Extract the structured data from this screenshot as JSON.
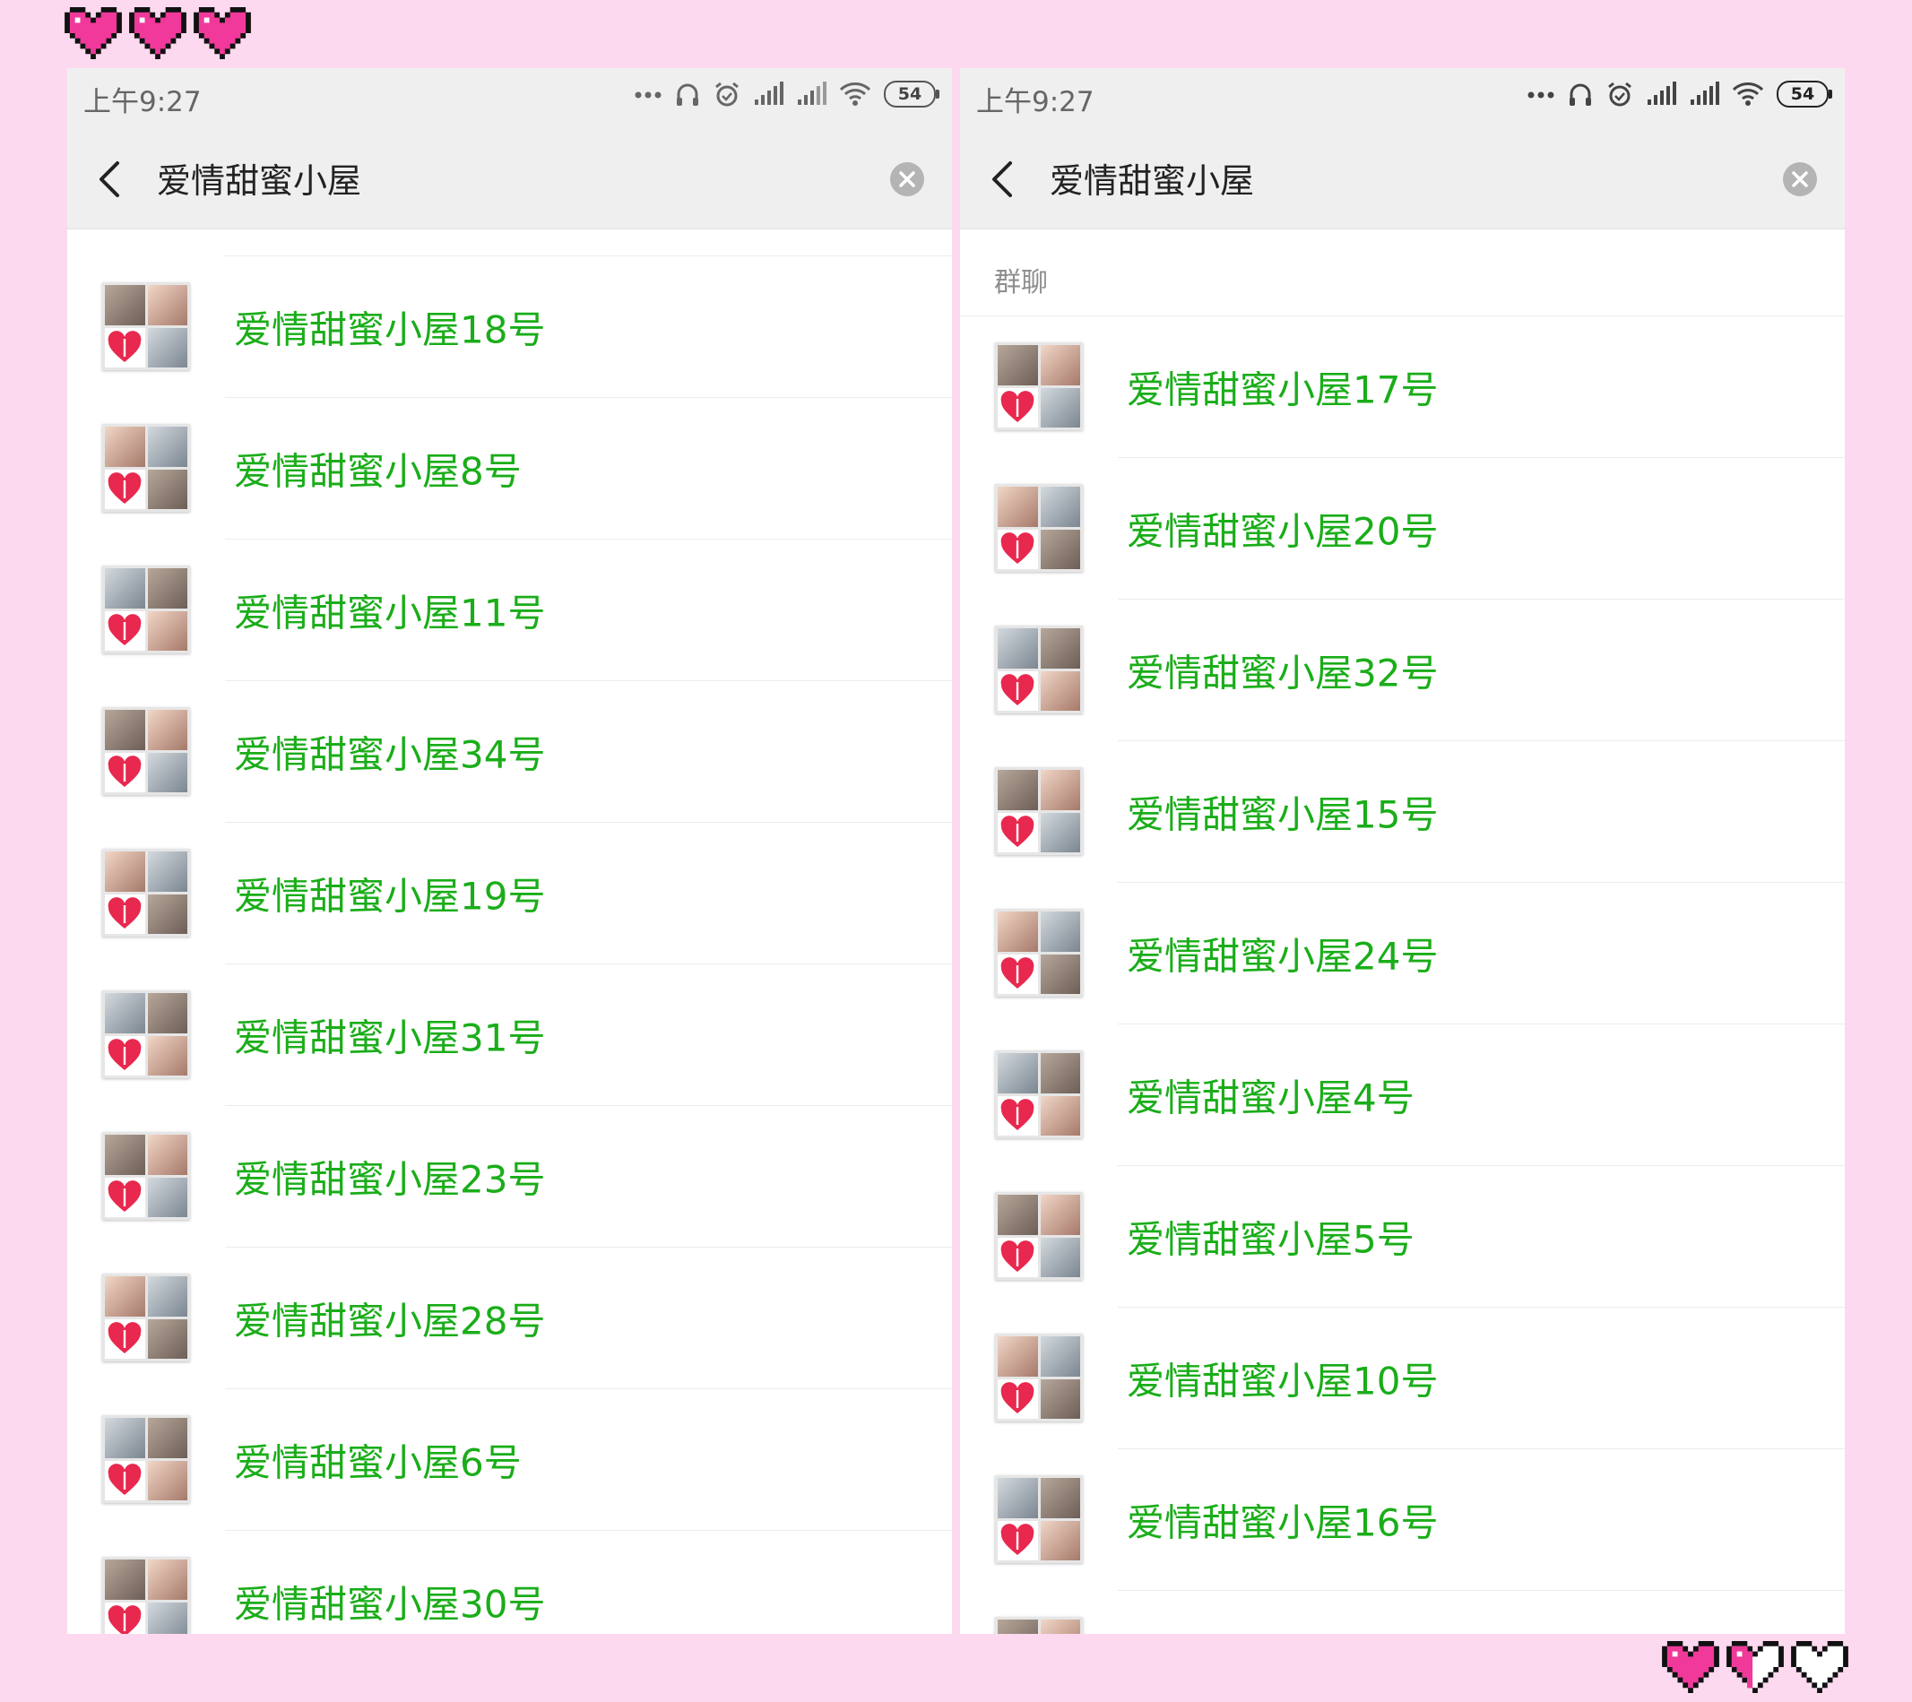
{
  "decor": {
    "top_hearts": [
      "filled",
      "filled",
      "filled"
    ],
    "bottom_hearts": [
      "filled",
      "half",
      "empty"
    ],
    "heart_color": "#f0399a"
  },
  "screens": [
    {
      "status": {
        "time": "上午9:27",
        "battery": "54"
      },
      "search": {
        "query": "爱情甜蜜小屋"
      },
      "section": "",
      "rows": [
        {
          "name": "爱情甜蜜小屋18号"
        },
        {
          "name": "爱情甜蜜小屋8号"
        },
        {
          "name": "爱情甜蜜小屋11号"
        },
        {
          "name": "爱情甜蜜小屋34号"
        },
        {
          "name": "爱情甜蜜小屋19号"
        },
        {
          "name": "爱情甜蜜小屋31号"
        },
        {
          "name": "爱情甜蜜小屋23号"
        },
        {
          "name": "爱情甜蜜小屋28号"
        },
        {
          "name": "爱情甜蜜小屋6号"
        },
        {
          "name": "爱情甜蜜小屋30号"
        }
      ]
    },
    {
      "status": {
        "time": "上午9:27",
        "battery": "54"
      },
      "search": {
        "query": "爱情甜蜜小屋"
      },
      "section": "群聊",
      "rows": [
        {
          "name": "爱情甜蜜小屋17号"
        },
        {
          "name": "爱情甜蜜小屋20号"
        },
        {
          "name": "爱情甜蜜小屋32号"
        },
        {
          "name": "爱情甜蜜小屋15号"
        },
        {
          "name": "爱情甜蜜小屋24号"
        },
        {
          "name": "爱情甜蜜小屋4号"
        },
        {
          "name": "爱情甜蜜小屋5号"
        },
        {
          "name": "爱情甜蜜小屋10号"
        },
        {
          "name": "爱情甜蜜小屋16号"
        },
        {
          "name": ""
        }
      ]
    }
  ],
  "icons": {
    "back": "chevron-left-icon",
    "clear": "clear-circle-icon",
    "status": [
      "more-dots-icon",
      "headset-icon",
      "alarm-icon",
      "signal-icon",
      "signal-icon",
      "wifi-icon",
      "battery-icon"
    ]
  },
  "colors": {
    "result_name": "#1aad19",
    "bar_bg": "#efefef",
    "page_bg": "#fdd9ef"
  }
}
